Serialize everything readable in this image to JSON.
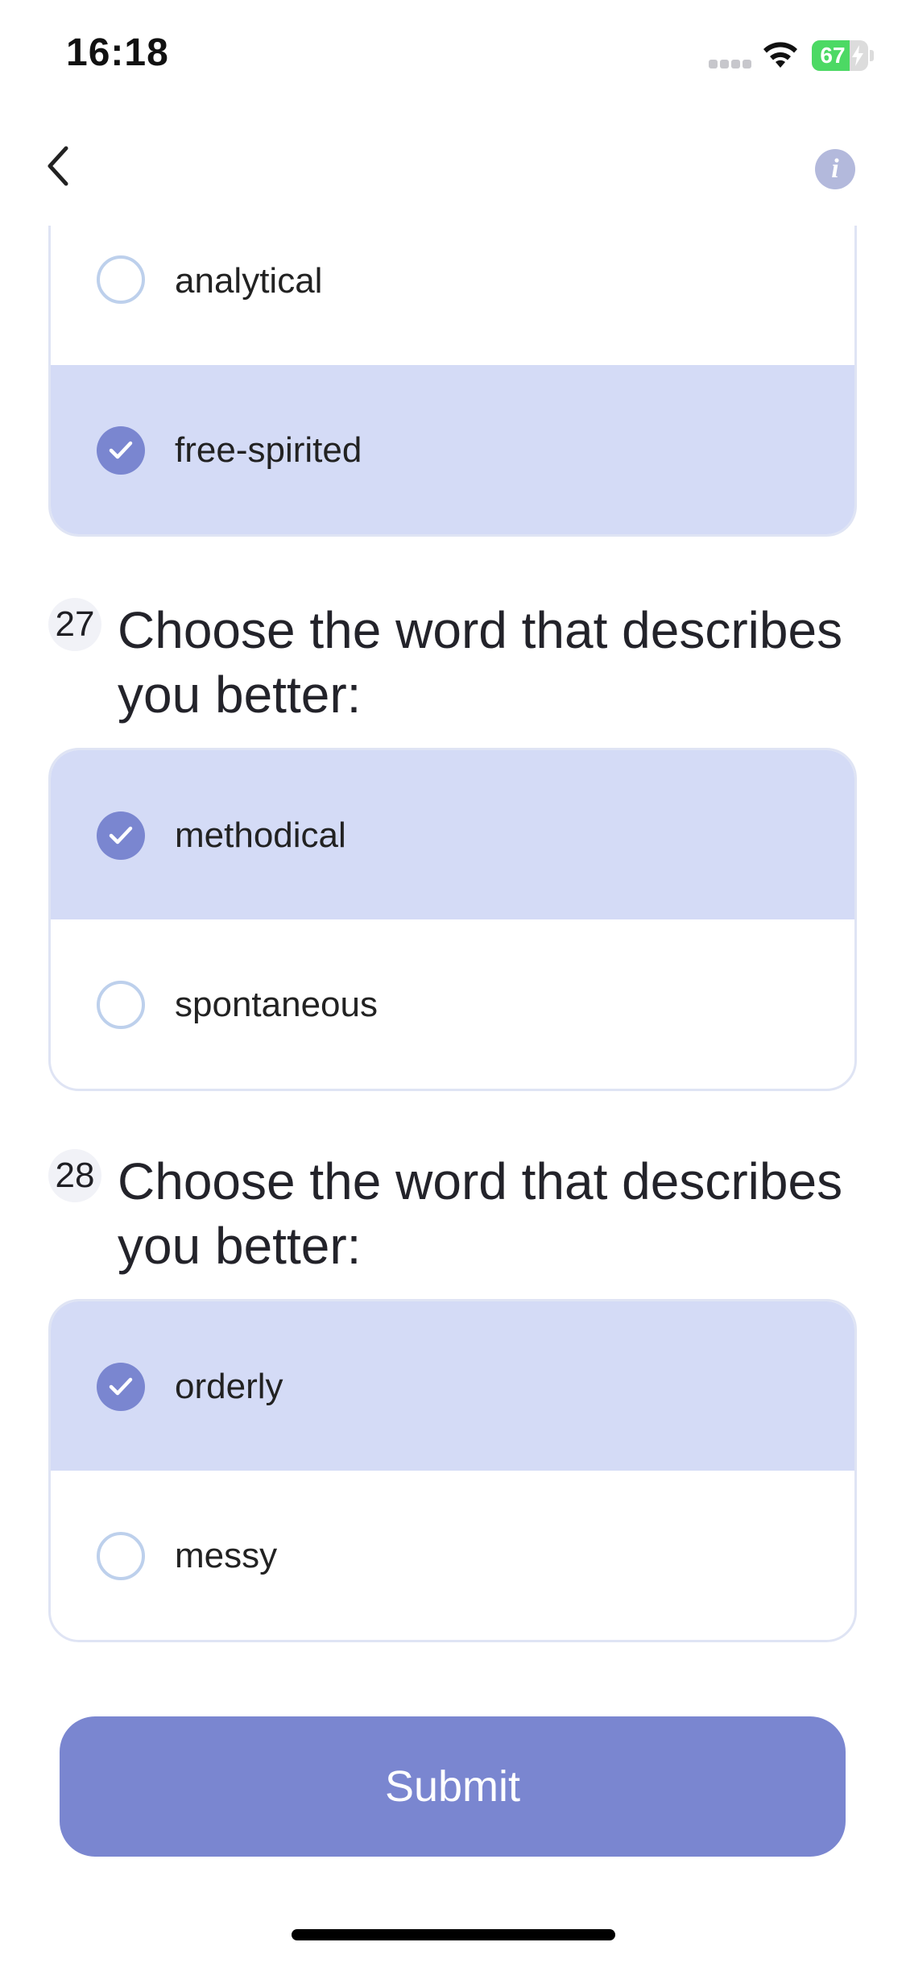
{
  "status_bar": {
    "time": "16:18",
    "battery_level": "67",
    "battery_fraction": 0.67,
    "icons": [
      "signal-icon",
      "wifi-icon",
      "battery-charging-icon"
    ]
  },
  "nav": {
    "back_icon": "chevron-left-icon",
    "info_icon": "info-icon",
    "info_glyph": "i"
  },
  "partial_group": {
    "options": [
      {
        "label": "analytical",
        "selected": false
      },
      {
        "label": "free-spirited",
        "selected": true
      }
    ]
  },
  "questions": [
    {
      "number": "27",
      "text": "Choose the word that describes you better:",
      "options": [
        {
          "label": "methodical",
          "selected": true
        },
        {
          "label": "spontaneous",
          "selected": false
        }
      ]
    },
    {
      "number": "28",
      "text": "Choose the word that describes you better:",
      "options": [
        {
          "label": "orderly",
          "selected": true
        },
        {
          "label": "messy",
          "selected": false
        }
      ]
    }
  ],
  "submit": {
    "label": "Submit"
  },
  "colors": {
    "accent": "#7a86d0",
    "selected_bg": "#d4dbf6",
    "card_border": "#dfe4f4",
    "radio_border": "#bdd0ec",
    "battery_green": "#4cd964"
  }
}
